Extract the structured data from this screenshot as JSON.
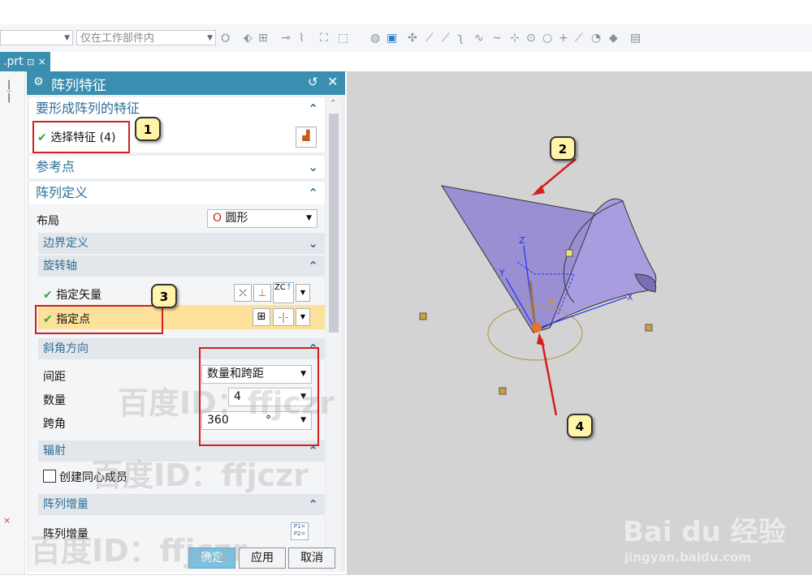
{
  "toolbar": {
    "filter_placeholder": "",
    "scope_label": "仅在工作部件内"
  },
  "tab": {
    "label": ".prt",
    "pin": "⊡",
    "close": "×"
  },
  "dialog": {
    "title": "阵列特征",
    "feature_section": {
      "title": "要形成阵列的特征",
      "select_label": "选择特征 (4)"
    },
    "reference_section": {
      "title": "参考点"
    },
    "pattern_section": {
      "title": "阵列定义",
      "layout_label": "布局",
      "layout_value": "圆形",
      "boundary_title": "边界定义",
      "rotation_title": "旋转轴",
      "vector_label": "指定矢量",
      "point_label": "指定点",
      "zc_label": "ZC",
      "angle_dir_title": "斜角方向",
      "spacing_label": "间距",
      "spacing_value": "数量和跨距",
      "count_label": "数量",
      "count_value": "4",
      "span_label": "跨角",
      "span_value": "360",
      "span_unit": "°",
      "radial_title": "辐射",
      "concentric_label": "创建同心成员",
      "increment_title": "阵列增量",
      "increment_label": "阵列增量",
      "increment_icon": "P1= P2="
    },
    "buttons": {
      "ok": "确定",
      "apply": "应用",
      "cancel": "取消"
    }
  },
  "callouts": [
    "1",
    "2",
    "3",
    "4"
  ],
  "axes": {
    "x": "X",
    "y": "Y",
    "z": "Z"
  },
  "watermarks": {
    "baidu_id": "百度ID：ffjczr",
    "baidu_logo": "Bai du 经验",
    "baidu_url": "jingyan.baidu.com"
  }
}
